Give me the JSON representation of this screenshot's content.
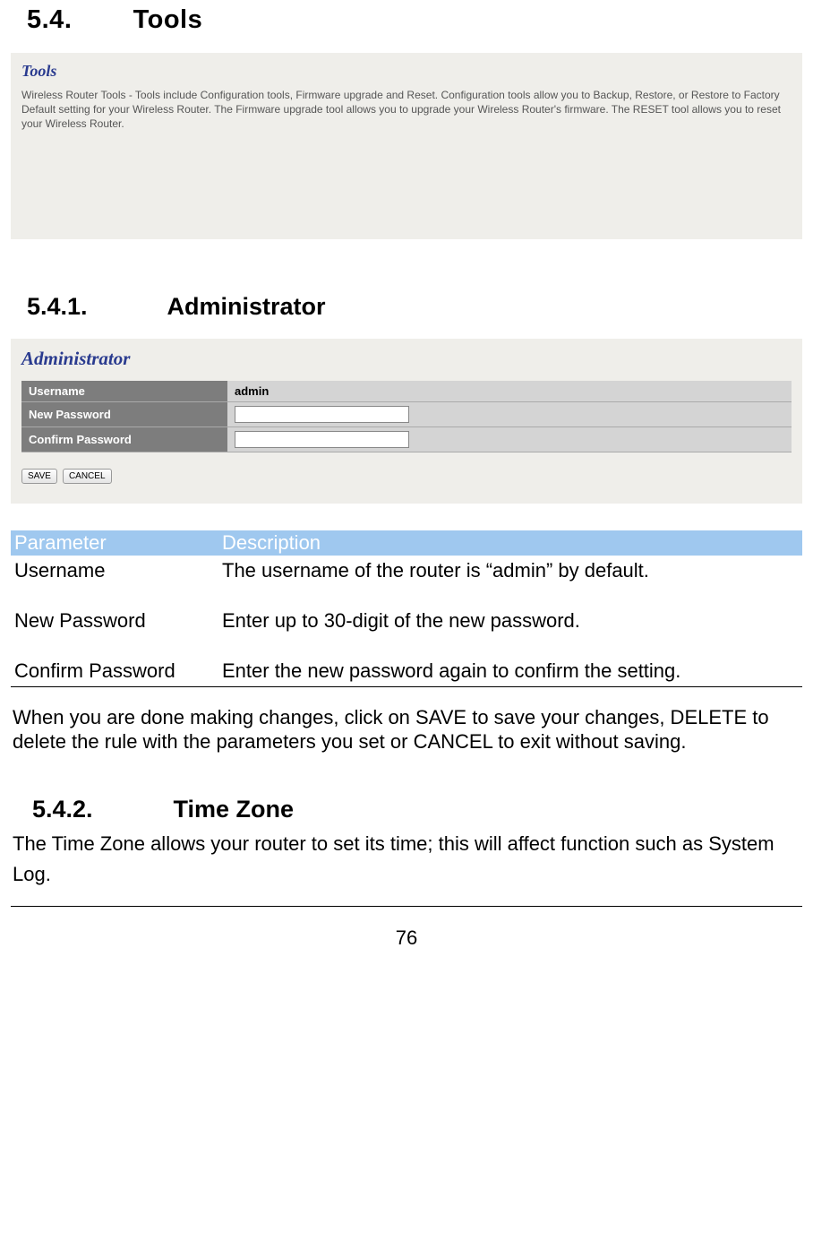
{
  "section1": {
    "number": "5.4.",
    "title": "Tools"
  },
  "tools_panel": {
    "heading": "Tools",
    "description": "Wireless Router Tools - Tools include Configuration tools, Firmware upgrade and Reset. Configuration tools allow you to Backup, Restore, or Restore to Factory Default setting for your Wireless Router. The Firmware upgrade tool allows you to upgrade your Wireless Router's firmware. The RESET tool allows you to reset your Wireless Router."
  },
  "section1_1": {
    "number": "5.4.1.",
    "title": "Administrator"
  },
  "admin_panel": {
    "heading": "Administrator",
    "rows": [
      {
        "label": "Username",
        "value": "admin",
        "type": "static"
      },
      {
        "label": "New Password",
        "value": "",
        "type": "password"
      },
      {
        "label": "Confirm Password",
        "value": "",
        "type": "password"
      }
    ],
    "buttons": {
      "save": "SAVE",
      "cancel": "CANCEL"
    }
  },
  "param_table": {
    "headers": {
      "param": "Parameter",
      "desc": "Description"
    },
    "rows": [
      {
        "param": "Username",
        "desc": "The username of the router is “admin” by default."
      },
      {
        "param": "New Password",
        "desc": "Enter up to 30-digit of the new password."
      },
      {
        "param": "Confirm Password",
        "desc": "Enter the new password again to confirm the setting."
      }
    ]
  },
  "body_paragraph": "When you are done making changes, click on SAVE to save your changes, DELETE to delete the rule with the parameters you set or CANCEL to exit without saving.",
  "section1_2": {
    "number": "5.4.2.",
    "title": "Time Zone",
    "description": "The Time Zone allows your router to set its time; this will affect function such as System Log."
  },
  "page_number": "76"
}
